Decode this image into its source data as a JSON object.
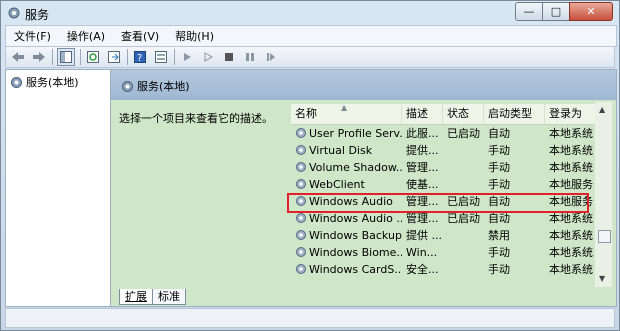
{
  "window": {
    "title": "服务",
    "buttons": {
      "minimize": "—",
      "maximize": "□",
      "close": "✕"
    }
  },
  "menu": [
    "文件(F)",
    "操作(A)",
    "查看(V)",
    "帮助(H)"
  ],
  "toolbar_icons": [
    "back-arrow-icon",
    "forward-arrow-icon",
    "console-tree-icon",
    "refresh-icon",
    "export-list-icon",
    "help-icon",
    "properties-icon",
    "play-icon",
    "play-outline-icon",
    "stop-icon",
    "pause-icon",
    "restart-icon"
  ],
  "tree": {
    "item": "服务(本地)"
  },
  "pane": {
    "header": "服务(本地)",
    "description": "选择一个项目来查看它的描述。"
  },
  "grid": {
    "columns": [
      "名称",
      "描述",
      "状态",
      "启动类型",
      "登录为"
    ],
    "rows": [
      [
        "User Profile Serv...",
        "此服...",
        "已启动",
        "自动",
        "本地系统"
      ],
      [
        "Virtual Disk",
        "提供...",
        "",
        "手动",
        "本地系统"
      ],
      [
        "Volume Shadow...",
        "管理...",
        "",
        "手动",
        "本地系统"
      ],
      [
        "WebClient",
        "使基...",
        "",
        "手动",
        "本地服务"
      ],
      [
        "Windows Audio",
        "管理...",
        "已启动",
        "自动",
        "本地服务"
      ],
      [
        "Windows Audio ...",
        "管理...",
        "已启动",
        "自动",
        "本地系统"
      ],
      [
        "Windows Backup",
        "提供 ...",
        "",
        "禁用",
        "本地系统"
      ],
      [
        "Windows Biome...",
        "Win...",
        "",
        "手动",
        "本地系统"
      ],
      [
        "Windows CardS...",
        "安全...",
        "",
        "手动",
        "本地系统"
      ]
    ],
    "selected_index": 4,
    "highlight_color": "#e0202a"
  },
  "tabs": [
    "扩展",
    "标准"
  ],
  "colors": {
    "pane_bg": "#cfe6c8",
    "header_bg": "#a9c1d9"
  }
}
